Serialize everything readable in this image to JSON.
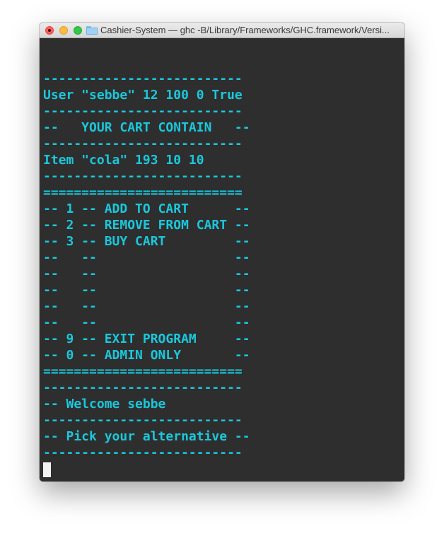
{
  "window": {
    "title": "Cashier-System — ghc -B/Library/Frameworks/GHC.framework/Versi..."
  },
  "terminal": {
    "text_color": "#1ac8dc",
    "background": "#2e2e2e",
    "lines": [
      "--------------------------",
      "User \"sebbe\" 12 100 0 True",
      "--------------------------",
      "--   YOUR CART CONTAIN   --",
      "--------------------------",
      "Item \"cola\" 193 10 10",
      "--------------------------",
      "==========================",
      "-- 1 -- ADD TO CART      --",
      "-- 2 -- REMOVE FROM CART --",
      "-- 3 -- BUY CART         --",
      "--   --                  --",
      "--   --                  --",
      "--   --                  --",
      "--   --                  --",
      "--   --                  --",
      "-- 9 -- EXIT PROGRAM     --",
      "-- 0 -- ADMIN ONLY       --",
      "==========================",
      "--------------------------",
      "-- Welcome sebbe",
      "--------------------------",
      "-- Pick your alternative --",
      "--------------------------"
    ]
  }
}
